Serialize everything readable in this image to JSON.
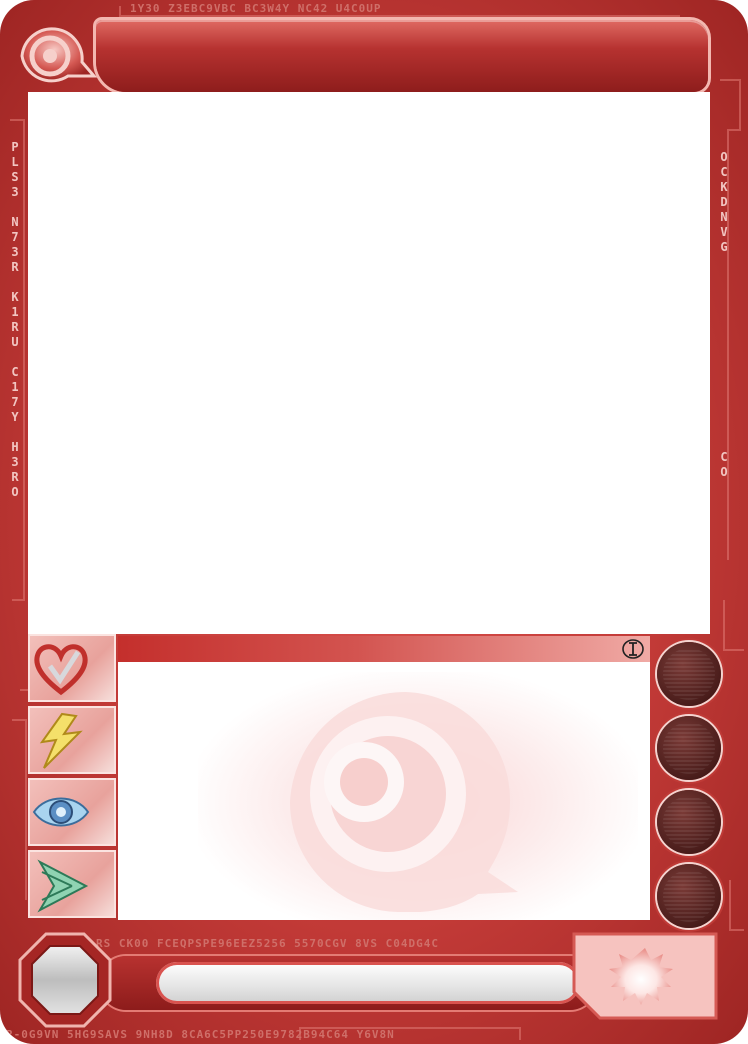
{
  "card": {
    "frame_color": "#c23a37",
    "accent_light": "#f3b7b0",
    "title": "",
    "type_line": "",
    "body_text": "",
    "name": "",
    "level": "",
    "type_icon": "type-symbol-icon",
    "emblem_icon": "eye-swirl-emblem-icon"
  },
  "border_codes": {
    "top": "1Y30 Z3EBC9VBC BC3W4Y NC42 U4C0UP",
    "bottom_upper": "RS CK00 FCEQPSPE96EEZ5256 5570CGV 8VS C04DG4C",
    "bottom_lower": "R-0G9VN 5HG9SAVS 9NH8D 8CA6C5PP250E9782B94C64 Y6V8N",
    "left_column": [
      "P",
      "L",
      "S",
      "3",
      "",
      "N",
      "7",
      "3",
      "R",
      "",
      "K",
      "1",
      "R",
      "U",
      "",
      "C",
      "1",
      "7",
      "Y",
      "",
      "H",
      "3",
      "R",
      "O"
    ],
    "right_column": [
      "O",
      "C",
      "K",
      "D",
      "N",
      "V",
      "G",
      "",
      "",
      "",
      "",
      "",
      "",
      "",
      "",
      "",
      "",
      "",
      "",
      "",
      "C",
      "O"
    ]
  },
  "stats": [
    {
      "icon": "heart-icon",
      "value": ""
    },
    {
      "icon": "lightning-icon",
      "value": ""
    },
    {
      "icon": "eye-icon",
      "value": ""
    },
    {
      "icon": "speed-arrow-icon",
      "value": ""
    }
  ],
  "orbs": [
    {
      "icon": "resource-orb-icon"
    },
    {
      "icon": "resource-orb-icon"
    },
    {
      "icon": "resource-orb-icon"
    },
    {
      "icon": "resource-orb-icon"
    }
  ]
}
